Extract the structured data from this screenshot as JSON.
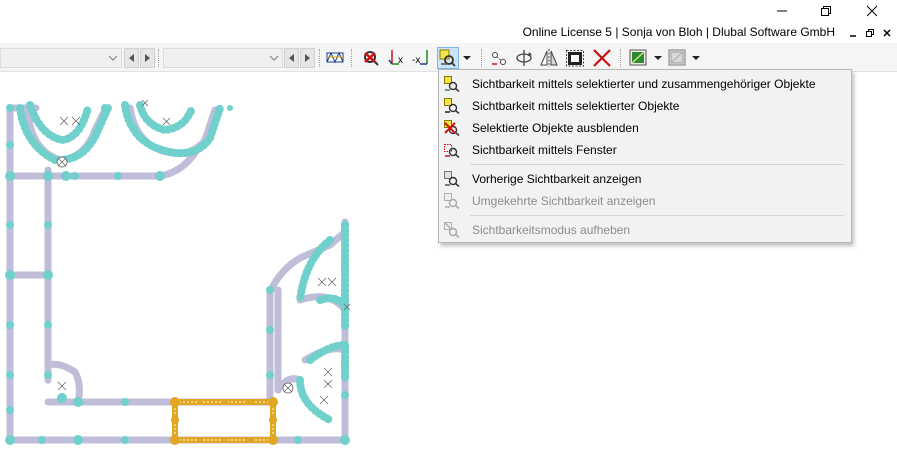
{
  "titlebar": {
    "minimize_icon": "minimize-icon",
    "restore_icon": "restore-icon",
    "close_icon": "close-icon"
  },
  "license": {
    "text": "Online License 5 | Sonja von Bloh | Dlubal Software GmbH"
  },
  "toolbar": {
    "combo1_value": "",
    "combo2_value": "",
    "icons": [
      "load-path-icon",
      "visibility-delete-icon",
      "axis-x-icon",
      "axis-minus-x-icon",
      "visibility-selection-icon",
      "node-connect-icon",
      "rotate-icon",
      "mirror-icon",
      "select-window-icon",
      "cross-delete-icon",
      "view-render-icon",
      "view-wireframe-icon"
    ]
  },
  "menu": {
    "items": [
      {
        "label": "Sichtbarkeit mittels selektierter und zusammengehöriger Objekte",
        "icon": "visibility-related-icon",
        "enabled": true
      },
      {
        "label": "Sichtbarkeit mittels selektierter Objekte",
        "icon": "visibility-selected-icon",
        "enabled": true
      },
      {
        "label": "Selektierte Objekte ausblenden",
        "icon": "hide-selected-icon",
        "enabled": true
      },
      {
        "label": "Sichtbarkeit mittels Fenster",
        "icon": "visibility-window-icon",
        "enabled": true
      },
      {
        "label": "Vorherige Sichtbarkeit anzeigen",
        "icon": "previous-visibility-icon",
        "enabled": true
      },
      {
        "label": "Umgekehrte Sichtbarkeit anzeigen",
        "icon": "inverse-visibility-icon",
        "enabled": false
      },
      {
        "label": "Sichtbarkeitsmodus aufheben",
        "icon": "cancel-visibility-icon",
        "enabled": false
      }
    ]
  },
  "colors": {
    "member": "#c0bdd8",
    "node": "#6fd0cc",
    "selected": "#e0a624",
    "menu_bg": "#f2f2f2",
    "active_btn": "#cce4f7"
  }
}
